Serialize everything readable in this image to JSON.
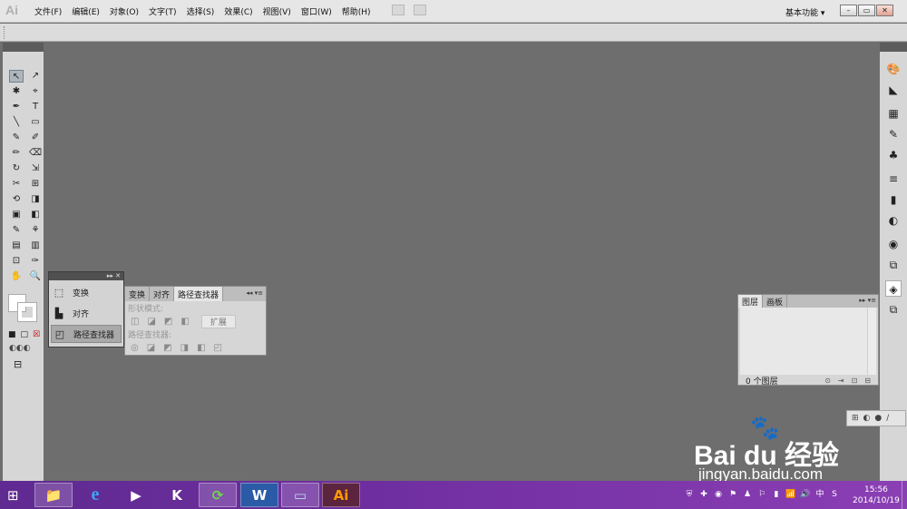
{
  "app": {
    "logo": "Ai",
    "menu": [
      "文件(F)",
      "编辑(E)",
      "对象(O)",
      "文字(T)",
      "选择(S)",
      "效果(C)",
      "视图(V)",
      "窗口(W)",
      "帮助(H)"
    ],
    "workspace": "基本功能 ▾",
    "window_buttons": [
      "–",
      "▭",
      "✕"
    ]
  },
  "tools": [
    "↖",
    "↗",
    "✱",
    "⌖",
    "✒",
    "T",
    "╲",
    "▭",
    "✎",
    "✐",
    "✏",
    "⌫",
    "↻",
    "⇲",
    "✂",
    "⊞",
    "⟲",
    "◨",
    "▣",
    "◧",
    "✎",
    "⚘",
    "▤",
    "▥",
    "⊡",
    "✑",
    "✋",
    "🔍"
  ],
  "tools_bottom": [
    "■",
    "□",
    "☒"
  ],
  "right_icons": [
    "color-icon",
    "color-guide-icon",
    "swatches-icon",
    "brushes-icon",
    "symbols-icon",
    "stroke-icon",
    "gradient-icon",
    "transparency-icon",
    "appearance-icon",
    "graphic-styles-icon",
    "layers-icon",
    "artboards-icon"
  ],
  "right_glyphs": [
    "🎨",
    "◣",
    "▦",
    "✎",
    "♣",
    "≡",
    "▮",
    "◐",
    "◉",
    "⧉",
    "◈",
    "⧉"
  ],
  "panel_list": {
    "items": [
      {
        "icon": "⬚",
        "label": "变换"
      },
      {
        "icon": "▙",
        "label": "对齐"
      },
      {
        "icon": "◰",
        "label": "路径查找器"
      }
    ],
    "controls": "▸▸ ✕"
  },
  "pathfinder": {
    "tabs": [
      "变换",
      "对齐",
      "路径查找器"
    ],
    "shape_modes_label": "形状模式:",
    "pathfinders_label": "路径查找器:",
    "shape_buttons": [
      "◫",
      "◪",
      "◩",
      "◧"
    ],
    "path_buttons": [
      "◎",
      "◪",
      "◩",
      "◨",
      "◧",
      "◰"
    ],
    "expand": "扩展",
    "controls": "◂◂  ▾≡"
  },
  "layers": {
    "tabs": [
      "图层",
      "画板"
    ],
    "footer": "0 个图层",
    "footer_icons": [
      "⊙",
      "⇥",
      "⊡",
      "⊟"
    ],
    "controls": "▸▸  ▾≡"
  },
  "minibar": [
    "⊞",
    "◐",
    "●",
    "∕"
  ],
  "watermark": {
    "brand": "Bai du 经验",
    "url": "jingyan.baidu.com"
  },
  "taskbar": {
    "apps": [
      "📁",
      "e",
      "▶",
      "K",
      "⟳",
      "W",
      "▭",
      "Ai"
    ],
    "tray": [
      "⛨",
      "✚",
      "◉",
      "⚑",
      "♟",
      "⚐",
      "▮",
      "📶",
      "🔊",
      "中",
      "S"
    ],
    "time": "15:56",
    "date": "2014/10/19"
  }
}
